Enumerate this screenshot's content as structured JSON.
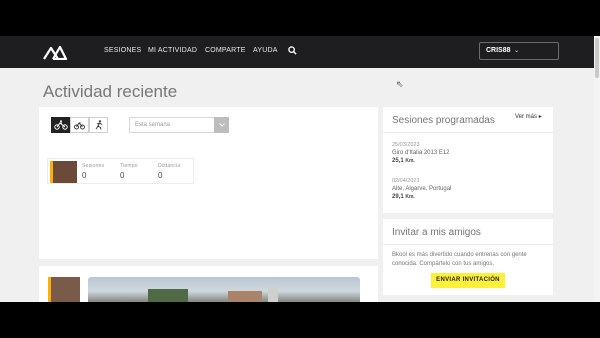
{
  "nav": {
    "items": [
      "SESIONES",
      "MI ACTIVIDAD",
      "COMPARTE",
      "AYUDA"
    ],
    "user": "CRIS88"
  },
  "page": {
    "title": "Actividad reciente"
  },
  "filter": {
    "period_placeholder": "Esta semana"
  },
  "stats": [
    {
      "label": "Sesiones",
      "value": "0"
    },
    {
      "label": "Tiempo",
      "value": "0"
    },
    {
      "label": "Distancia",
      "value": "0"
    }
  ],
  "scheduled": {
    "title": "Sesiones programadas",
    "see_more": "Ver más",
    "sessions": [
      {
        "date": "25/03/2023",
        "name": "Giro d'Italia 2013 E12",
        "km": "25,1",
        "unit": "Km."
      },
      {
        "date": "02/04/2023",
        "name": "Alte, Algarve, Portugal",
        "km": "29,1",
        "unit": "Km."
      }
    ]
  },
  "invite": {
    "title": "Invitar a mis amigos",
    "text": "Bkool es más divertido cuando entrenas con gente conocida. Compártelo con tus amigos.",
    "button": "ENVIAR INVITACIÓN"
  },
  "colors": {
    "accent": "#fff03a",
    "nav_bg": "#1e1e21",
    "bg": "#f0f0f0"
  }
}
